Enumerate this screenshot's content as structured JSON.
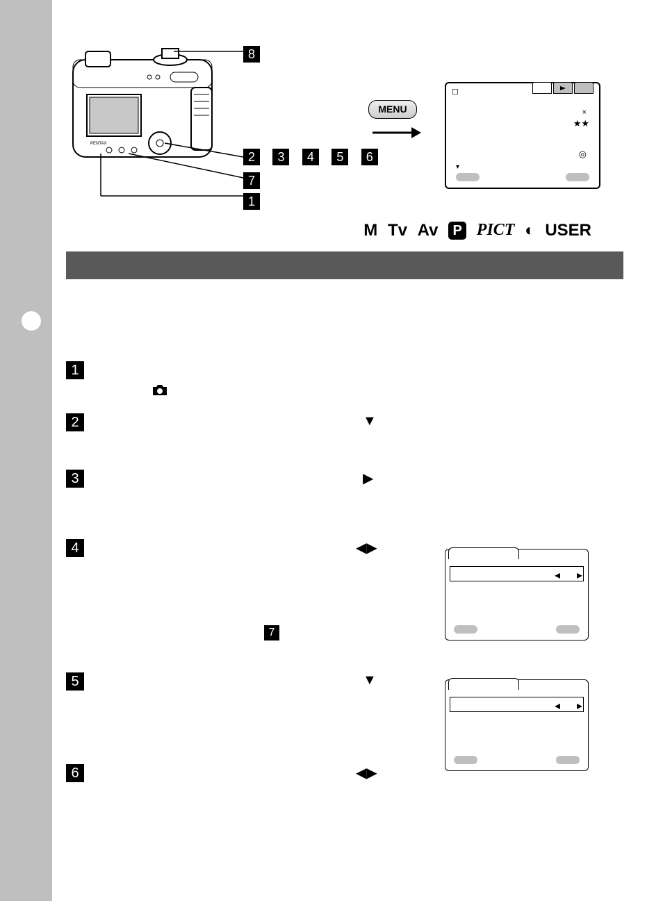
{
  "callouts": {
    "c1": "1",
    "c2": "2",
    "c3": "3",
    "c4": "4",
    "c5": "5",
    "c6": "6",
    "c7": "7",
    "c8": "8"
  },
  "menu_label": "MENU",
  "lcd_main": {
    "tabs_count": 3,
    "corner_icons": {
      "times": "×",
      "stars": "★★",
      "metering": "◎"
    },
    "scroll": "▾"
  },
  "modes": {
    "m": "M",
    "tv": "Tv",
    "av": "Av",
    "p": "P",
    "pict": "PICT",
    "half": "◐",
    "user": "USER"
  },
  "steps": {
    "s1": "1",
    "s2": "2",
    "s3": "3",
    "s4": "4",
    "s5": "5",
    "s6": "6",
    "sub7": "7"
  },
  "glyphs": {
    "camera": "📷",
    "down": "▼",
    "right": "▶",
    "left": "◀",
    "play": "▶"
  },
  "lcd_small": {
    "arrow_l": "◂",
    "arrow_r": "▸"
  }
}
